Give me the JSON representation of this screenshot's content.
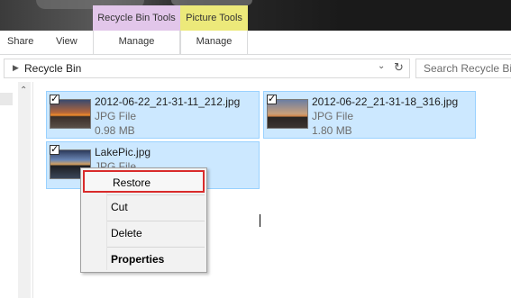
{
  "ribbon": {
    "tabs": [
      "Share",
      "View"
    ],
    "context_groups": [
      {
        "header": "Recycle Bin Tools",
        "tab": "Manage",
        "color": "#e2c6ea"
      },
      {
        "header": "Picture Tools",
        "tab": "Manage",
        "color": "#ece97a"
      }
    ]
  },
  "address": {
    "path": "Recycle Bin",
    "search_placeholder": "Search Recycle Bin"
  },
  "files": [
    {
      "name": "2012-06-22_21-31-11_212.jpg",
      "type": "JPG File",
      "size": "0.98 MB",
      "checked": true
    },
    {
      "name": "2012-06-22_21-31-18_316.jpg",
      "type": "JPG File",
      "size": "1.80 MB",
      "checked": true
    },
    {
      "name": "LakePic.jpg",
      "type": "JPG File",
      "size": "",
      "checked": true
    }
  ],
  "context_menu": {
    "items": [
      "Restore",
      "Cut",
      "Delete",
      "Properties"
    ],
    "highlighted": "Restore",
    "highlight_color": "#d92b2b"
  },
  "colors": {
    "selection_fill": "#cce8ff",
    "selection_border": "#99d1ff"
  }
}
